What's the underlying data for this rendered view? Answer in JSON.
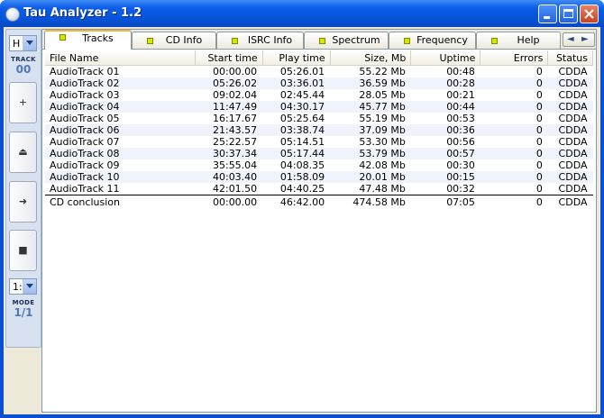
{
  "window": {
    "title": "Tau Analyzer - 1.2",
    "controls": {
      "minimize": "minimize",
      "maximize": "maximize",
      "close": "close"
    }
  },
  "left_panel": {
    "top_combo": "H",
    "track_label": "TRACK",
    "track_value": "00",
    "buttons": [
      {
        "name": "add",
        "glyph": "+"
      },
      {
        "name": "eject",
        "glyph": "⏏"
      },
      {
        "name": "next",
        "glyph": "➜"
      },
      {
        "name": "stop",
        "glyph": "■"
      }
    ],
    "bottom_combo": "1:",
    "mode_label": "MODE",
    "mode_value": "1/1"
  },
  "tabs": [
    {
      "label": "Tracks",
      "active": true
    },
    {
      "label": "CD Info",
      "active": false
    },
    {
      "label": "ISRC Info",
      "active": false
    },
    {
      "label": "Spectrum",
      "active": false
    },
    {
      "label": "Frequency",
      "active": false
    },
    {
      "label": "Help",
      "active": false
    }
  ],
  "tab_nav": {
    "prev": "◄",
    "next": "►"
  },
  "table": {
    "columns": [
      "File Name",
      "Start time",
      "Play time",
      "Size, Mb",
      "Uptime",
      "Errors",
      "Status"
    ],
    "rows": [
      [
        "AudioTrack 01",
        "00:00.00",
        "05:26.01",
        "55.22 Mb",
        "00:48",
        "0",
        "CDDA"
      ],
      [
        "AudioTrack 02",
        "05:26.02",
        "03:36.01",
        "36.59 Mb",
        "00:28",
        "0",
        "CDDA"
      ],
      [
        "AudioTrack 03",
        "09:02.04",
        "02:45.44",
        "28.05 Mb",
        "00:21",
        "0",
        "CDDA"
      ],
      [
        "AudioTrack 04",
        "11:47.49",
        "04:30.17",
        "45.77 Mb",
        "00:44",
        "0",
        "CDDA"
      ],
      [
        "AudioTrack 05",
        "16:17.67",
        "05:25.64",
        "55.19 Mb",
        "00:53",
        "0",
        "CDDA"
      ],
      [
        "AudioTrack 06",
        "21:43.57",
        "03:38.74",
        "37.09 Mb",
        "00:36",
        "0",
        "CDDA"
      ],
      [
        "AudioTrack 07",
        "25:22.57",
        "05:14.51",
        "53.30 Mb",
        "00:56",
        "0",
        "CDDA"
      ],
      [
        "AudioTrack 08",
        "30:37.34",
        "05:17.44",
        "53.79 Mb",
        "00:57",
        "0",
        "CDDA"
      ],
      [
        "AudioTrack 09",
        "35:55.04",
        "04:08.35",
        "42.08 Mb",
        "00:30",
        "0",
        "CDDA"
      ],
      [
        "AudioTrack 10",
        "40:03.40",
        "01:58.09",
        "20.01 Mb",
        "00:15",
        "0",
        "CDDA"
      ],
      [
        "AudioTrack 11",
        "42:01.50",
        "04:40.25",
        "47.48 Mb",
        "00:32",
        "0",
        "CDDA"
      ]
    ],
    "total": [
      "CD conclusion",
      "00:00.00",
      "46:42.00",
      "474.58 Mb",
      "07:05",
      "0",
      "CDDA"
    ]
  }
}
